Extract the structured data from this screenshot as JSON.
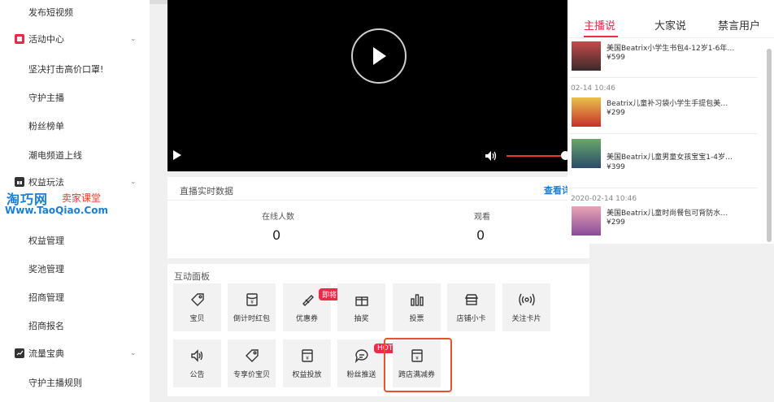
{
  "sidebar": {
    "item_publish": "发布短视频",
    "group_activity": "活动中心",
    "activity_items": [
      "坚决打击高价口罩!",
      "守护主播",
      "粉丝榜单",
      "潮电频道上线"
    ],
    "group_rights": "权益玩法",
    "rights_items": [
      "权益管理",
      "奖池管理",
      "招商管理",
      "招商报名"
    ],
    "group_traffic": "流量宝典",
    "traffic_items": [
      "守护主播规则"
    ]
  },
  "watermark": {
    "name": "淘巧网",
    "course": "卖家课堂",
    "url": "Www.TaoQiao.Com"
  },
  "realtime": {
    "title": "直播实时数据",
    "link": "查看详",
    "online_label": "在线人数",
    "online_value": "0",
    "views_label": "观看",
    "views_value": "0"
  },
  "interaction": {
    "title": "互动面板",
    "tiles": [
      {
        "label": "宝贝",
        "icon": "tag-icon"
      },
      {
        "label": "倒计时红包",
        "icon": "red-envelope-icon"
      },
      {
        "label": "优惠券",
        "icon": "coupon-icon",
        "badge": "即将下线"
      },
      {
        "label": "抽奖",
        "icon": "gift-icon"
      },
      {
        "label": "投票",
        "icon": "bar-chart-icon"
      },
      {
        "label": "店铺小卡",
        "icon": "store-icon"
      },
      {
        "label": "关注卡片",
        "icon": "broadcast-icon"
      },
      {
        "label": "公告",
        "icon": "speaker-icon"
      },
      {
        "label": "专享价宝贝",
        "icon": "tag-icon"
      },
      {
        "label": "权益投放",
        "icon": "yen-box-icon"
      },
      {
        "label": "粉丝推送",
        "icon": "chat-icon",
        "badge": "HOT"
      },
      {
        "label": "跨店满减券",
        "icon": "yen-box-icon"
      }
    ]
  },
  "right_panel": {
    "tabs": [
      "主播说",
      "大家说",
      "禁言用户"
    ],
    "items": [
      {
        "time": "",
        "name": "美国Beatrix小学生书包4-12岁1-6年…",
        "price": "¥599"
      },
      {
        "time": "02-14 10:46",
        "name": "Beatrix儿童补习袋小学生手提包美…",
        "price": "¥299"
      },
      {
        "time": "",
        "name": "美国Beatrix儿童男童女孩宝宝1-4岁…",
        "price": "¥399"
      },
      {
        "time": "2020-02-14 10:46",
        "name": "美国Beatrix儿童时尚餐包可背防水…",
        "price": "¥299"
      }
    ]
  },
  "colors": {
    "accent": "#f0284a",
    "link": "#1a7fd4",
    "highlight": "#e8522c"
  }
}
